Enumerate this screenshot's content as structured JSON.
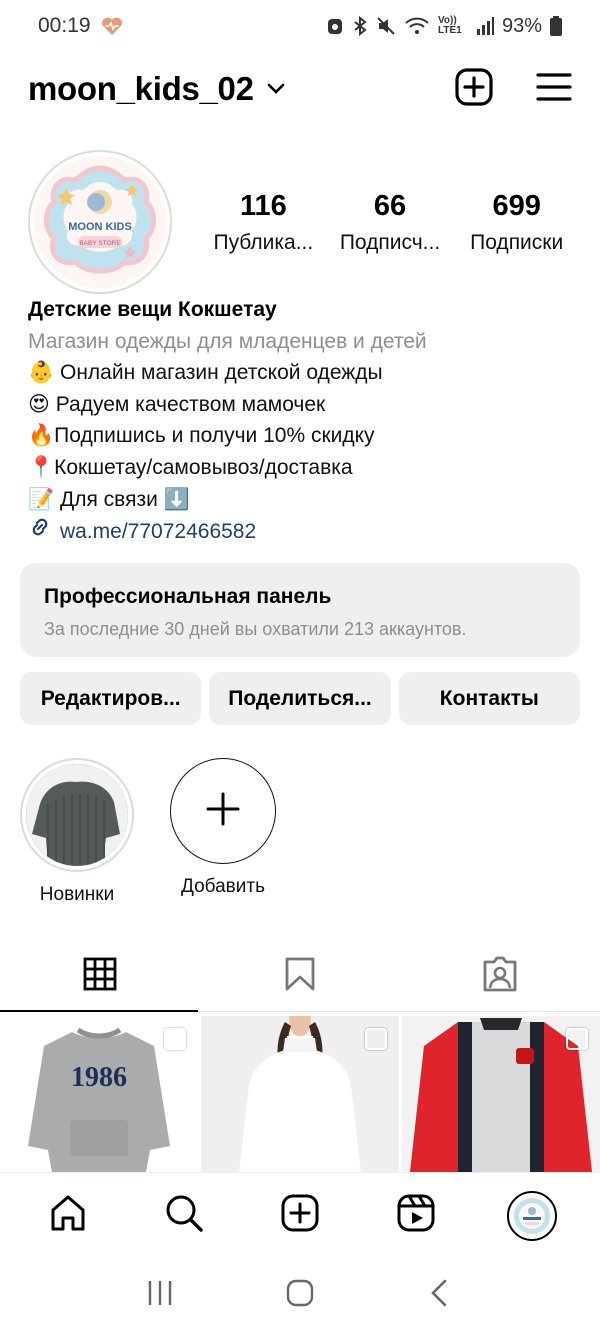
{
  "status_bar": {
    "time": "00:19",
    "battery": "93%",
    "network": "Vo)) LTE1"
  },
  "header": {
    "username": "moon_kids_02"
  },
  "avatar": {
    "brand_line1": "MOON KIDS",
    "brand_line2": "BABY STORE"
  },
  "stats": [
    {
      "value": "116",
      "label": "Публика..."
    },
    {
      "value": "66",
      "label": "Подписч..."
    },
    {
      "value": "699",
      "label": "Подписки"
    }
  ],
  "bio": {
    "name": "Детские вещи Кокшетау",
    "category": "Магазин одежды для младенцев и детей",
    "lines": [
      "👶 Онлайн магазин детской одежды",
      "😍 Радуем качеством мамочек",
      "🔥Подпишись и получи 10% скидку",
      "📍Кокшетау/самовывоз/доставка",
      "📝 Для связи ⬇️"
    ],
    "link": "wa.me/77072466582"
  },
  "pro_panel": {
    "title": "Профессиональная панель",
    "subtitle": "За последние 30 дней вы охватили 213 аккаунтов."
  },
  "actions": {
    "edit": "Редактиров...",
    "share": "Поделиться...",
    "contacts": "Контакты"
  },
  "highlights": [
    {
      "label": "Новинки"
    },
    {
      "label": "Добавить"
    }
  ],
  "grid": {
    "post1_print": "1986"
  },
  "colors": {
    "link": "#1d3f72",
    "muted": "#8e8e8e",
    "panel_bg": "#efefef",
    "status_heart": "#e79a7a"
  }
}
